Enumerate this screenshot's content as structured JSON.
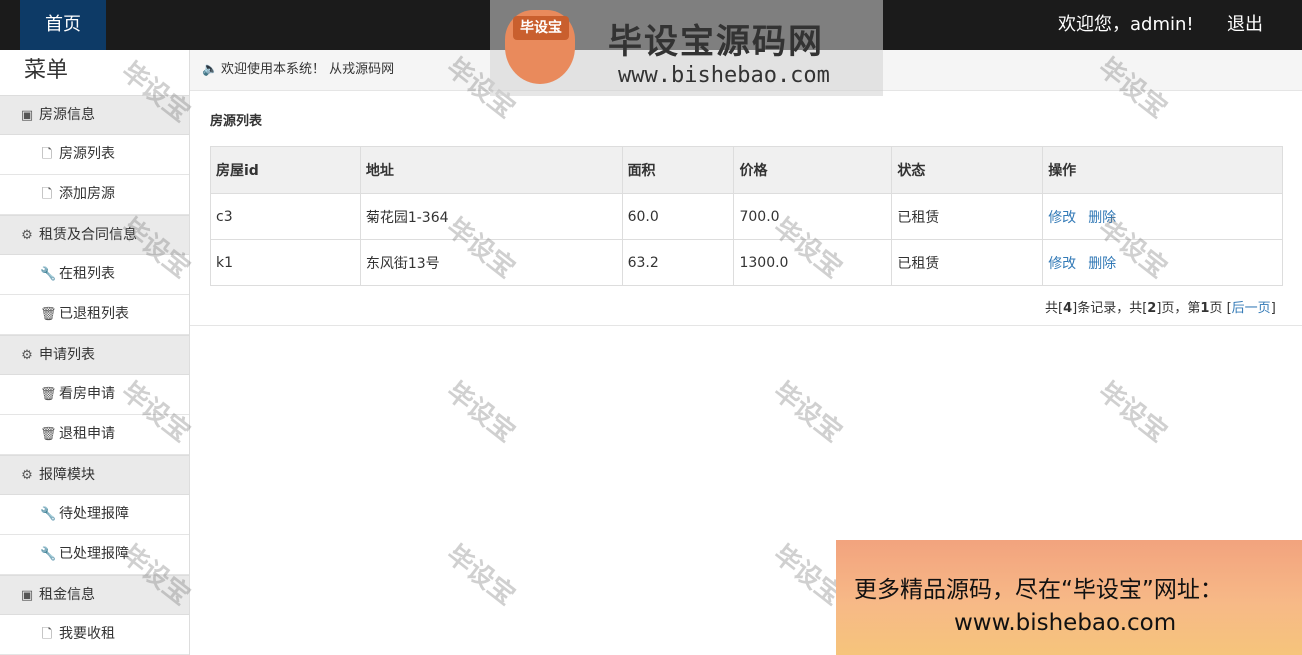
{
  "topbar": {
    "home_label": "首页",
    "welcome": "欢迎您，admin!",
    "logout_label": "退出"
  },
  "sidebar": {
    "title": "菜单",
    "groups": [
      {
        "label": "房源信息",
        "icon": "b-square-icon",
        "items": [
          {
            "label": "房源列表",
            "icon": "file-icon"
          },
          {
            "label": "添加房源",
            "icon": "file-icon"
          }
        ]
      },
      {
        "label": "租赁及合同信息",
        "icon": "gear-icon",
        "items": [
          {
            "label": "在租列表",
            "icon": "wrench-icon"
          },
          {
            "label": "已退租列表",
            "icon": "trash-icon"
          }
        ]
      },
      {
        "label": "申请列表",
        "icon": "gear-icon",
        "items": [
          {
            "label": "看房申请",
            "icon": "trash-icon"
          },
          {
            "label": "退租申请",
            "icon": "trash-icon"
          }
        ]
      },
      {
        "label": "报障模块",
        "icon": "gear-icon",
        "items": [
          {
            "label": "待处理报障",
            "icon": "wrench-icon"
          },
          {
            "label": "已处理报障",
            "icon": "wrench-icon"
          }
        ]
      },
      {
        "label": "租金信息",
        "icon": "b-square-icon",
        "items": [
          {
            "label": "我要收租",
            "icon": "file-icon"
          }
        ]
      }
    ]
  },
  "breadcrumb": {
    "icon": "speaker-icon",
    "text": "欢迎使用本系统！ 从戎源码网"
  },
  "main": {
    "list_title": "房源列表",
    "table": {
      "headers": [
        "房屋id",
        "地址",
        "面积",
        "价格",
        "状态",
        "操作"
      ],
      "rows": [
        {
          "id": "c3",
          "address": "菊花园1-364",
          "area": "60.0",
          "price": "700.0",
          "status": "已租赁",
          "edit": "修改",
          "delete": "删除"
        },
        {
          "id": "k1",
          "address": "东风街13号",
          "area": "63.2",
          "price": "1300.0",
          "status": "已租赁",
          "edit": "修改",
          "delete": "删除"
        }
      ]
    },
    "pager": {
      "prefix": "共[",
      "records": "4",
      "mid1": "]条记录，共[",
      "pages": "2",
      "mid2": "]页，第",
      "current": "1",
      "mid3": "页 [",
      "next_label": "后一页",
      "suffix": "]"
    }
  },
  "overlay": {
    "logo_badge": "毕设宝",
    "logo_title": "毕设宝源码网",
    "logo_url": "www.bishebao.com",
    "watermark": "毕设宝",
    "promo_line1": "更多精品源码，尽在“毕设宝”网址：",
    "promo_line2": "www.bishebao.com"
  }
}
